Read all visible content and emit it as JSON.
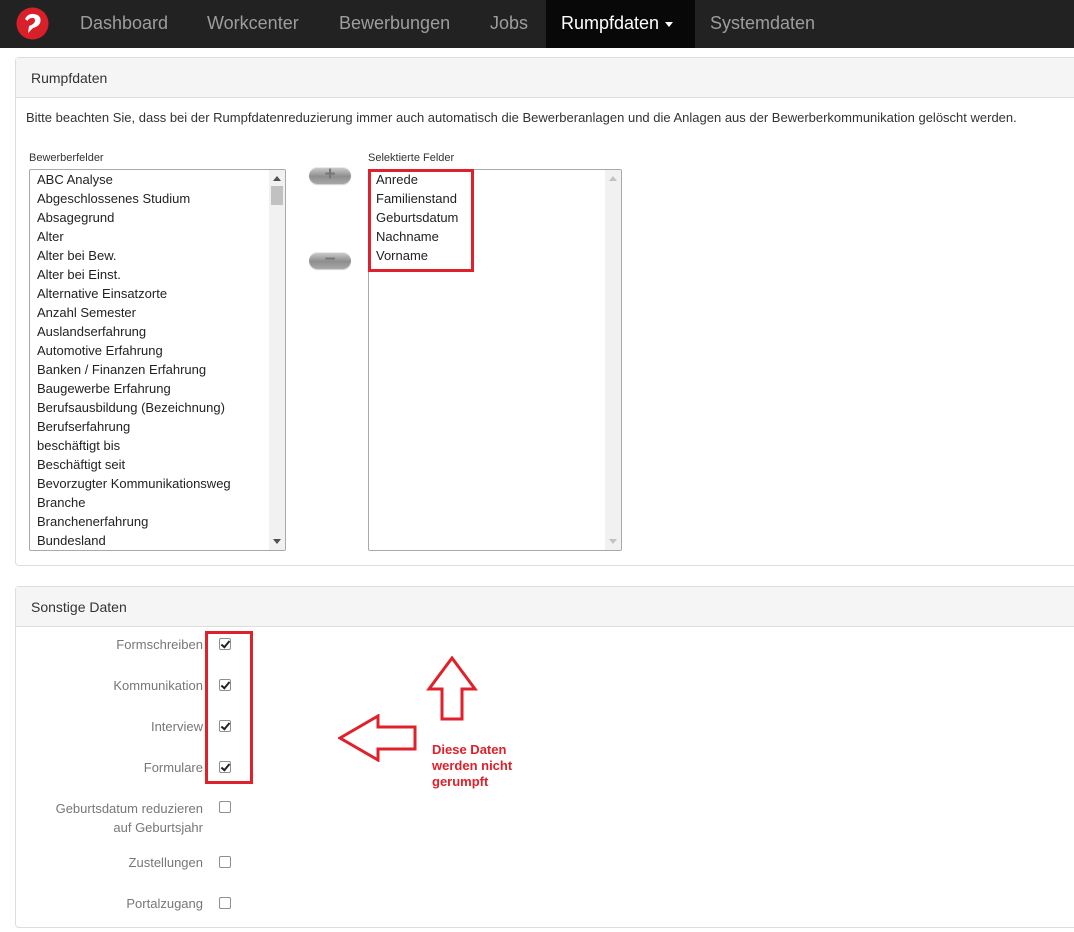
{
  "nav": {
    "items": [
      {
        "label": "Dashboard"
      },
      {
        "label": "Workcenter"
      },
      {
        "label": "Bewerbungen"
      },
      {
        "label": "Jobs"
      },
      {
        "label": "Rumpfdaten"
      },
      {
        "label": "Systemdaten"
      }
    ],
    "active_index": 4
  },
  "rumpfdaten_panel": {
    "title": "Rumpfdaten",
    "notice": "Bitte beachten Sie, dass bei der Rumpfdatenreduzierung immer auch automatisch die Bewerberanlagen und die Anlagen aus der Bewerberkommunikation gelöscht werden.",
    "available_label": "Bewerberfelder",
    "selected_label": "Selektierte Felder",
    "available_fields": [
      "ABC Analyse",
      "Abgeschlossenes Studium",
      "Absagegrund",
      "Alter",
      "Alter bei Bew.",
      "Alter bei Einst.",
      "Alternative Einsatzorte",
      "Anzahl Semester",
      "Auslandserfahrung",
      "Automotive Erfahrung",
      "Banken / Finanzen Erfahrung",
      "Baugewerbe Erfahrung",
      "Berufsausbildung (Bezeichnung)",
      "Berufserfahrung",
      "beschäftigt bis",
      "Beschäftigt seit",
      "Bevorzugter Kommunikationsweg",
      "Branche",
      "Branchenerfahrung",
      "Bundesland"
    ],
    "selected_fields": [
      "Anrede",
      "Familienstand",
      "Geburtsdatum",
      "Nachname",
      "Vorname"
    ],
    "add_button": "+",
    "remove_button": "−"
  },
  "sonstige_panel": {
    "title": "Sonstige Daten",
    "options": [
      {
        "label": "Formschreiben",
        "checked": true
      },
      {
        "label": "Kommunikation",
        "checked": true
      },
      {
        "label": "Interview",
        "checked": true
      },
      {
        "label": "Formulare",
        "checked": true
      },
      {
        "label_line1": "Geburtsdatum reduzieren",
        "label_line2": "auf Geburtsjahr",
        "checked": false
      },
      {
        "label": "Zustellungen",
        "checked": false
      },
      {
        "label": "Portalzugang",
        "checked": false
      }
    ]
  },
  "annotation": {
    "line1": "Diese Daten",
    "line2": "werden nicht",
    "line3": "gerumpft",
    "color": "#e0202a"
  },
  "colors": {
    "navbar": "#222222",
    "nav_active": "#080808",
    "logo_red": "#d9202a",
    "highlight_red": "#e0202a"
  }
}
